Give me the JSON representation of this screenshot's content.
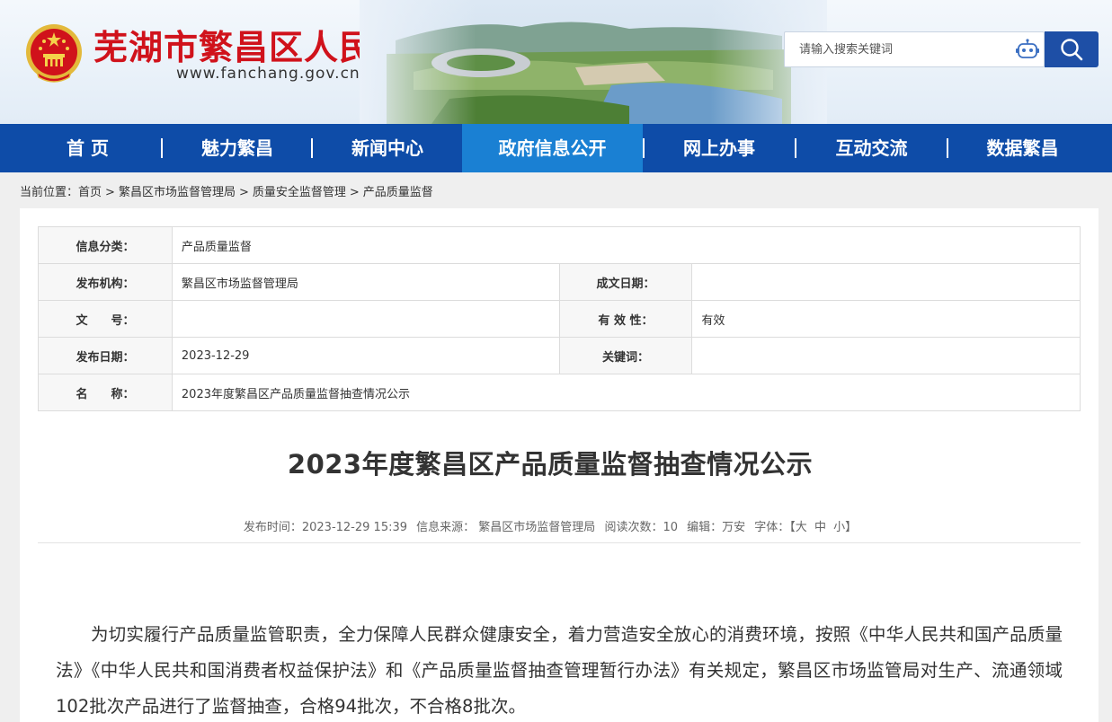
{
  "header": {
    "site_title": "芜湖市繁昌区人民政府",
    "site_url": "www.fanchang.gov.cn",
    "emblem_icon": "national-emblem-icon",
    "brand_color": "#d0121b"
  },
  "search": {
    "placeholder": "请输入搜索关键词",
    "assistant_icon": "robot-icon",
    "button_icon": "search-icon"
  },
  "nav": {
    "items": [
      {
        "label": "首 页"
      },
      {
        "label": "魅力繁昌"
      },
      {
        "label": "新闻中心"
      },
      {
        "label": "政府信息公开",
        "active": true
      },
      {
        "label": "网上办事"
      },
      {
        "label": "互动交流"
      },
      {
        "label": "数据繁昌"
      }
    ],
    "bg_color": "#0e4ca8",
    "active_color": "#1a80d3"
  },
  "breadcrumb": {
    "prefix": "当前位置：",
    "items": [
      "首页",
      "繁昌区市场监督管理局",
      "质量安全监督管理",
      "产品质量监督"
    ],
    "separator": ">"
  },
  "info": {
    "category_label": "信息分类：",
    "category_value": "产品质量监督",
    "publisher_label": "发布机构：",
    "publisher_value": "繁昌区市场监督管理局",
    "created_label": "成文日期：",
    "created_value": "",
    "doc_no_label": "文　　号：",
    "doc_no_value": "",
    "validity_label": "有 效 性：",
    "validity_value": "有效",
    "publish_date_label": "发布日期：",
    "publish_date_value": "2023-12-29",
    "keywords_label": "关键词：",
    "keywords_value": "",
    "name_label": "名　　称：",
    "name_value": "2023年度繁昌区产品质量监督抽查情况公示"
  },
  "article": {
    "title": "2023年度繁昌区产品质量监督抽查情况公示",
    "meta": {
      "time": "发布时间：2023-12-29 15:39",
      "source": "信息来源： 繁昌区市场监督管理局",
      "views": "阅读次数：10",
      "editor": "编辑：万安",
      "font_label": "字体：【",
      "font_large": "大",
      "font_medium": "中",
      "font_small": "小",
      "font_end": "】"
    },
    "body": "为切实履行产品质量监管职责，全力保障人民群众健康安全，着力营造安全放心的消费环境，按照《中华人民共和国产品质量法》《中华人民共和国消费者权益保护法》和《产品质量监督抽查管理暂行办法》有关规定，繁昌区市场监管局对生产、流通领域102批次产品进行了监督抽查，合格94批次，不合格8批次。"
  }
}
